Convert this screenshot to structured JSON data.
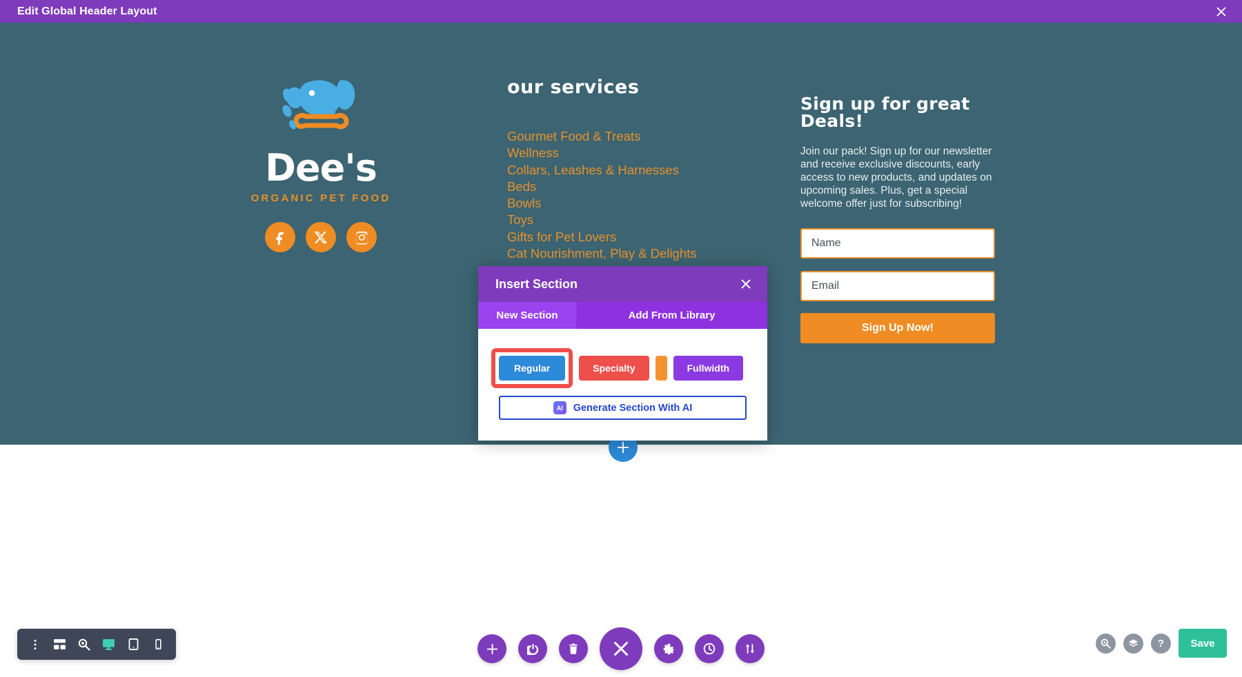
{
  "topbar": {
    "title": "Edit Global Header Layout",
    "close_icon": "close-icon"
  },
  "section_toolbar": {
    "icons": [
      "move-icon",
      "gear-icon",
      "duplicate-icon",
      "power-icon",
      "trash-icon",
      "more-options-icon"
    ]
  },
  "canvas": {
    "background_color": "#3c6472",
    "logo": {
      "wordmark": "Dee's",
      "tagline": "ORGANIC PET FOOD",
      "mark_icon": "dog-logo-icon",
      "social": [
        {
          "name": "facebook-icon",
          "label": "Facebook"
        },
        {
          "name": "x-twitter-icon",
          "label": "X"
        },
        {
          "name": "instagram-icon",
          "label": "Instagram"
        }
      ]
    },
    "services": {
      "heading": "our Services",
      "heading_first_letters": "o",
      "items": [
        "Gourmet Food & Treats",
        "Wellness",
        "Collars, Leashes & Harnesses",
        "Beds",
        "Bowls",
        "Toys",
        "Gifts for Pet Lovers",
        "Cat Nourishment, Play & Delights"
      ],
      "link_color": "#e8912a"
    },
    "signup": {
      "heading": "Sign up for great Deals!",
      "body": "Join our pack! Sign up for our newsletter and receive exclusive discounts, early access to new products, and updates on upcoming sales. Plus, get a special welcome offer just for subscribing!",
      "name_placeholder": "Name",
      "email_placeholder": "Email",
      "submit_label": "Sign Up Now!",
      "accent_color": "#ef8c23"
    }
  },
  "add_section_circle": {
    "icon": "plus-icon"
  },
  "modal": {
    "title": "Insert Section",
    "close_icon": "close-icon",
    "tabs": [
      {
        "label": "New Section",
        "active": true
      },
      {
        "label": "Add From Library",
        "active": false
      }
    ],
    "types": [
      {
        "label": "Regular",
        "color": "#2d8ad8",
        "highlighted": true
      },
      {
        "label": "Specialty",
        "color": "#ee4f4a",
        "highlighted": false
      },
      {
        "label": "",
        "color": "#f49230",
        "highlighted": false
      },
      {
        "label": "Fullwidth",
        "color": "#8a3ae0",
        "highlighted": false
      }
    ],
    "ai_button": {
      "badge": "AI",
      "label": "Generate Section With AI"
    },
    "highlight_color": "#ef4f4a"
  },
  "device_bar": {
    "icons": [
      {
        "name": "more-vertical-icon",
        "active": false
      },
      {
        "name": "wireframe-icon",
        "active": false
      },
      {
        "name": "zoom-icon",
        "active": false
      },
      {
        "name": "desktop-icon",
        "active": true
      },
      {
        "name": "tablet-icon",
        "active": false
      },
      {
        "name": "phone-icon",
        "active": false
      }
    ]
  },
  "fab_row": {
    "buttons": [
      {
        "name": "add-icon",
        "big": false
      },
      {
        "name": "power-icon",
        "big": false
      },
      {
        "name": "trash-icon",
        "big": false
      },
      {
        "name": "close-icon",
        "big": true
      },
      {
        "name": "settings-gear-icon",
        "big": false
      },
      {
        "name": "history-clock-icon",
        "big": false
      },
      {
        "name": "sort-updown-icon",
        "big": false
      }
    ]
  },
  "right_tools": {
    "icons": [
      "search-zoom-icon",
      "layers-icon",
      "help-icon"
    ],
    "save_label": "Save",
    "save_color": "#2fc09b"
  }
}
